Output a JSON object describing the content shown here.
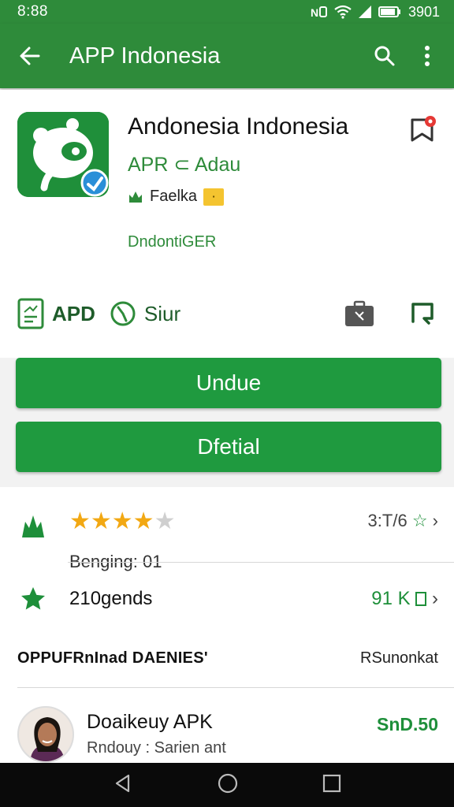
{
  "status_bar": {
    "time": "8:88",
    "right_text": "3901"
  },
  "app_bar": {
    "title": "APP Indonesia"
  },
  "app": {
    "name": "Andonesia Indonesia",
    "developer": "APR ⊂ Adau",
    "tag": "Faelka",
    "subtitle": "DndontiGER"
  },
  "meta": {
    "apk_label": "APD",
    "size_label": "Siur"
  },
  "buttons": {
    "primary": "Undue",
    "secondary": "Dfetial"
  },
  "rating": {
    "stars_filled": 4,
    "stars_total": 5,
    "value_text": "3:T/6",
    "count_text": "Benging: 01"
  },
  "legends": {
    "label": "210gends",
    "value_text": "91 K"
  },
  "section": {
    "title": "OPPUFRnInad DAENIES'",
    "link": "RSunonkat"
  },
  "review": {
    "name": "Doaikeuy APK",
    "sub": "Rndouy : Sarien ant",
    "price": "SnD.50"
  },
  "colors": {
    "primary": "#2e8b3a",
    "button": "#1f9a3f",
    "star": "#f2a813"
  }
}
